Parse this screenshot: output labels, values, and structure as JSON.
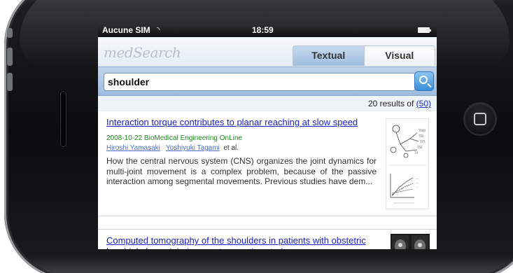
{
  "status_bar": {
    "carrier": "Aucune SIM",
    "wifi_icon": "wifi-icon",
    "time": "18:59",
    "battery_icon": "battery-icon"
  },
  "app": {
    "logo": "medSearch",
    "tabs": [
      {
        "label": "Textual",
        "active": true
      },
      {
        "label": "Visual",
        "active": false
      }
    ]
  },
  "search": {
    "value": "shoulder",
    "button_icon": "search-icon"
  },
  "results_summary": {
    "text": "20 results of",
    "link": "(50)"
  },
  "results": [
    {
      "title": "Interaction torque contributes to planar reaching at slow speed",
      "date_source": "2008-10-22   BioMedical Engineering OnLine",
      "authors": [
        "Hiroshi Yamasaki",
        "Yoshiyuki Tagami"
      ],
      "et_al": "et al.",
      "abstract": "How the central nervous system (CNS) organizes the joint dynamics for multi-joint movement is a complex problem, because of the passive interaction among segmental movements. Previous studies have dem...",
      "thumbnail_icon": "figure-thumbnail-icon"
    },
    {
      "title": "Computed tomography of the shoulders in patients with obstetric brachial plexus injuries: a retrospective study",
      "thumbnail_icon": "ct-scan-thumbnail-icon"
    }
  ],
  "colors": {
    "link": "#1a1fc6",
    "source_green": "#1c8a1c",
    "search_button": "#3b8fd8",
    "tab_active": "#9fbde0"
  }
}
